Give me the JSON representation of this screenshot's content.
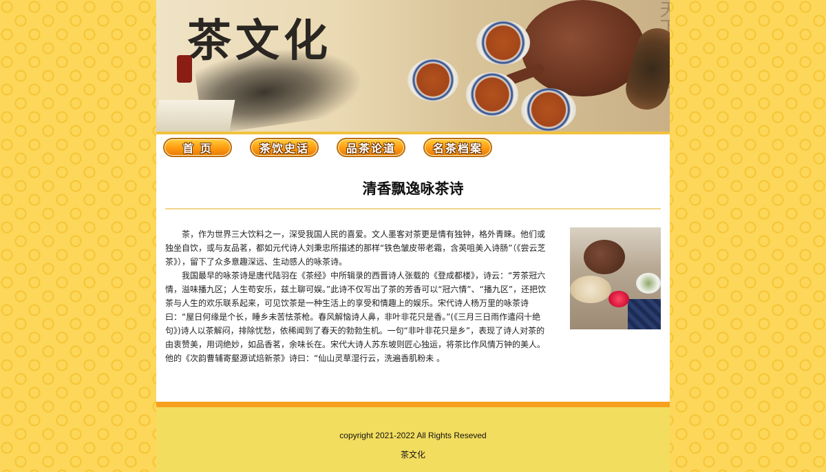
{
  "banner": {
    "title": "茶文化",
    "scroll_text": "天下雅茶成"
  },
  "nav": {
    "items": [
      {
        "label": "首 页"
      },
      {
        "label": "茶饮史话"
      },
      {
        "label": "品茶论道"
      },
      {
        "label": "名茶档案"
      }
    ]
  },
  "content": {
    "heading": "清香飘逸咏茶诗",
    "paragraphs": [
      "茶，作为世界三大饮料之一，深受我国人民的喜爱。文人墨客对茶更是情有独钟，格外青睐。他们或独坐自饮，或与友品茗，都如元代诗人刘秉忠所描述的那样“铁色皱皮带老霜，含英咀美入诗肠”（《尝云芝茶》），留下了众多意趣深远、生动感人的咏茶诗。",
      "我国最早的咏茶诗是唐代陆羽在《茶经》中所辑录的西晋诗人张载的《登成都楼》，诗云：“芳茶冠六情，溢味播九区；人生苟安乐，兹土聊可娱。”此诗不仅写出了茶的芳香可以“冠六情”、“播九区”，还把饮茶与人生的欢乐联系起来，可见饮茶是一种生活上的享受和情趣上的娱乐。宋代诗人杨万里的咏茶诗曰：“屋日何缘是个长，睡乡未苦怯茶枪。春风解恼诗人鼻，非叶非花只是香。”(《三月三日雨作遣闷十绝句》)诗人以茶解闷，排除忧愁，依稀闻到了春天的勃勃生机。一句“非叶非花只是乡”，表现了诗人对茶的由衷赞美，用词绝妙，如品香茗，余味长在。宋代大诗人苏东坡则匠心独运，将茶比作风情万钟的美人。他的《次韵曹辅寄壑源试焙新茶》诗曰：“仙山灵草湿行云，洗遍香肌粉未 。"
    ]
  },
  "footer": {
    "copyright": "copyright 2021-2022 All Rights Reseved",
    "site_name": "茶文化"
  },
  "colors": {
    "background": "#fcd75a",
    "footer_bg": "#f3dd5e",
    "footer_border": "#f7a01e",
    "divider": "#f0d689",
    "nav_button": "#ff9a10"
  }
}
